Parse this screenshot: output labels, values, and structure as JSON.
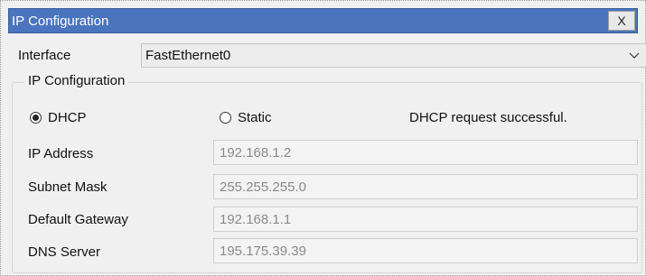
{
  "window": {
    "title": "IP Configuration",
    "close_label": "X"
  },
  "interface": {
    "label": "Interface",
    "selected": "FastEthernet0"
  },
  "ip_config": {
    "group_title": "IP Configuration",
    "dhcp_label": "DHCP",
    "static_label": "Static",
    "mode_selected": "DHCP",
    "status": "DHCP request successful.",
    "fields": {
      "ip_address": {
        "label": "IP Address",
        "value": "192.168.1.2"
      },
      "subnet_mask": {
        "label": "Subnet Mask",
        "value": "255.255.255.0"
      },
      "default_gateway": {
        "label": "Default Gateway",
        "value": "192.168.1.1"
      },
      "dns_server": {
        "label": "DNS Server",
        "value": "195.175.39.39"
      }
    }
  },
  "icons": {
    "chevron": "chevron-down-icon",
    "radio": "radio-button-icon"
  },
  "colors": {
    "titlebar": "#4a74be",
    "background": "#f0f0f0"
  }
}
